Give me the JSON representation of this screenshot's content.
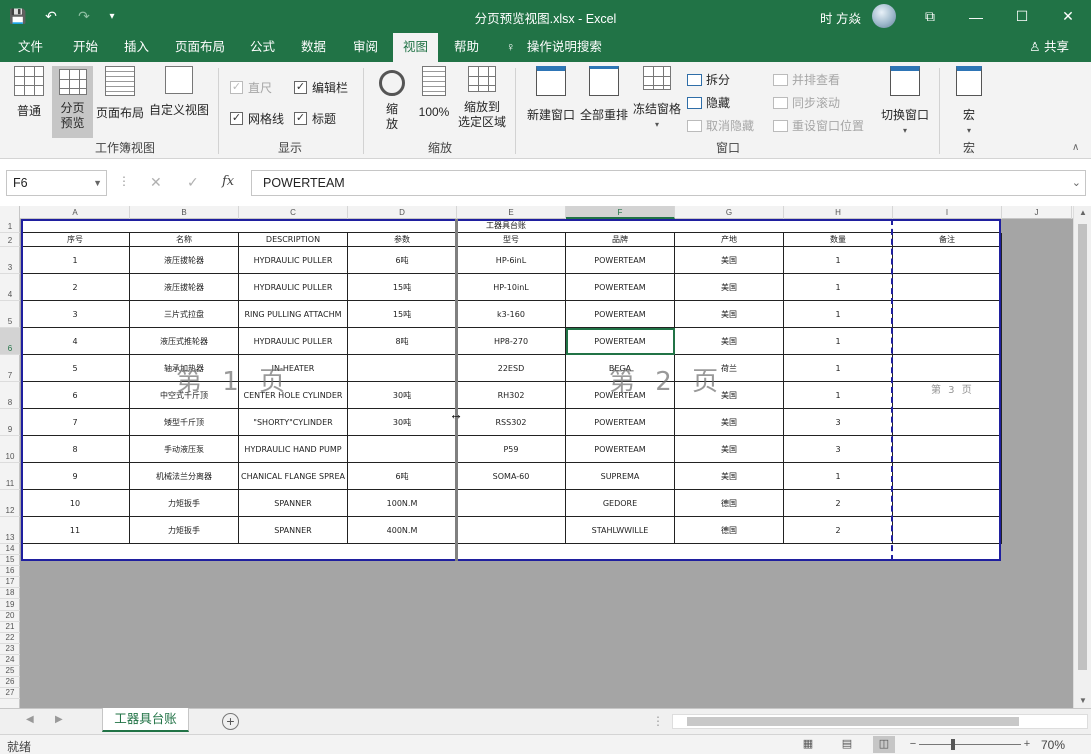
{
  "titlebar": {
    "title": "分页预览视图.xlsx - Excel",
    "user": "时 方焱",
    "save_icon": "💾",
    "undo_icon": "↶",
    "redo_icon": "↷",
    "more_icon": "▾",
    "restore_icon": "⧉",
    "minimize_icon": "—",
    "maximize_icon": "☐",
    "close_icon": "✕"
  },
  "tabs": [
    "文件",
    "开始",
    "插入",
    "页面布局",
    "公式",
    "数据",
    "审阅",
    "视图",
    "帮助"
  ],
  "active_tab": "视图",
  "tellme": "操作说明搜索",
  "share": "共享",
  "ribbon": {
    "workbook_views": {
      "label": "工作簿视图",
      "buttons": [
        "普通",
        "分页\n预览",
        "页面布局",
        "自定义视图"
      ]
    },
    "show": {
      "label": "显示",
      "ruler": "直尺",
      "formula_bar": "编辑栏",
      "gridlines": "网格线",
      "headings": "标题"
    },
    "zoom": {
      "label": "缩放",
      "zoom": "缩\n放",
      "hundred": "100%",
      "to_selection": "缩放到\n选定区域"
    },
    "window": {
      "label": "窗口",
      "new_window": "新建窗口",
      "arrange_all": "全部重排",
      "freeze_panes": "冻结窗格",
      "split": "拆分",
      "hide": "隐藏",
      "unhide": "取消隐藏",
      "side_by_side": "并排查看",
      "sync_scroll": "同步滚动",
      "reset_pos": "重设窗口位置",
      "switch": "切换窗口"
    },
    "macros": {
      "label": "宏",
      "macros": "宏"
    }
  },
  "formula_bar": {
    "namebox": "F6",
    "formula": "POWERTEAM",
    "cancel_icon": "✕",
    "enter_icon": "✓",
    "fx": "fx"
  },
  "columns": [
    "A",
    "B",
    "C",
    "D",
    "E",
    "F",
    "G",
    "H",
    "I",
    "J"
  ],
  "rows": [
    "1",
    "2",
    "3",
    "4",
    "5",
    "6",
    "7",
    "8",
    "9",
    "10",
    "11",
    "12",
    "13",
    "14",
    "15",
    "16",
    "17",
    "18",
    "19",
    "20",
    "21",
    "22",
    "23",
    "24",
    "25",
    "26",
    "27"
  ],
  "table": {
    "title": "工器具台账",
    "headers": [
      "序号",
      "名称",
      "DESCRIPTION",
      "参数",
      "型号",
      "品牌",
      "产地",
      "数量",
      "备注"
    ],
    "data": [
      [
        "1",
        "液压拔轮器",
        "HYDRAULIC PULLER",
        "6吨",
        "HP-6inL",
        "POWERTEAM",
        "美国",
        "1",
        ""
      ],
      [
        "2",
        "液压拔轮器",
        "HYDRAULIC PULLER",
        "15吨",
        "HP-10inL",
        "POWERTEAM",
        "美国",
        "1",
        ""
      ],
      [
        "3",
        "三片式拉盘",
        "RING PULLING ATTACHM",
        "15吨",
        "k3-160",
        "POWERTEAM",
        "美国",
        "1",
        ""
      ],
      [
        "4",
        "液压式推轮器",
        "HYDRAULIC PULLER",
        "8吨",
        "HP8-270",
        "POWERTEAM",
        "美国",
        "1",
        ""
      ],
      [
        "5",
        "轴承加热器",
        "IN-HEATER",
        "",
        "22ESD",
        "BEGA",
        "荷兰",
        "1",
        ""
      ],
      [
        "6",
        "中空式千斤顶",
        "CENTER HOLE CYLINDER",
        "30吨",
        "RH302",
        "POWERTEAM",
        "美国",
        "1",
        ""
      ],
      [
        "7",
        "矮型千斤顶",
        "\"SHORTY\"CYLINDER",
        "30吨",
        "RSS302",
        "POWERTEAM",
        "美国",
        "3",
        ""
      ],
      [
        "8",
        "手动液压泵",
        "HYDRAULIC HAND PUMP",
        "",
        "P59",
        "POWERTEAM",
        "美国",
        "3",
        ""
      ],
      [
        "9",
        "机械法兰分离器",
        "CHANICAL FLANGE SPREA",
        "6吨",
        "SOMA-60",
        "SUPREMA",
        "美国",
        "1",
        ""
      ],
      [
        "10",
        "力矩扳手",
        "SPANNER",
        "100N.M",
        "",
        "GEDORE",
        "德国",
        "2",
        ""
      ],
      [
        "11",
        "力矩扳手",
        "SPANNER",
        "400N.M",
        "",
        "STAHLWWILLE",
        "德国",
        "2",
        ""
      ]
    ]
  },
  "page_labels": [
    "第 1 页",
    "第 2 页",
    "第 3 页"
  ],
  "sheet_tab": "工器具台账",
  "add_sheet_icon": "⊕",
  "status": {
    "ready": "就绪",
    "zoom": "70%",
    "minus": "−",
    "plus": "+"
  },
  "colors": {
    "excel_green": "#217346",
    "page_border": "#1f1f9f"
  }
}
